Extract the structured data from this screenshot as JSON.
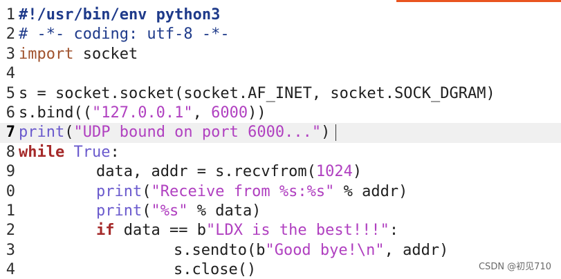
{
  "editor": {
    "accent_color": "#e95420",
    "lines": [
      {
        "num": "1",
        "tokens": [
          {
            "t": "#!/usr/bin/env python3",
            "c": "shebang"
          }
        ]
      },
      {
        "num": "2",
        "tokens": [
          {
            "t": "# -*- coding: utf-8 -*-",
            "c": "comment-line"
          }
        ]
      },
      {
        "num": "3",
        "tokens": [
          {
            "t": "import",
            "c": "kw-import"
          },
          {
            "t": " socket",
            "c": "plain"
          }
        ]
      },
      {
        "num": "4",
        "tokens": []
      },
      {
        "num": "5",
        "tokens": [
          {
            "t": "s = socket.socket(socket.AF_INET, socket.SOCK_DGRAM)",
            "c": "plain"
          }
        ]
      },
      {
        "num": "6",
        "tokens": [
          {
            "t": "s.bind((",
            "c": "plain"
          },
          {
            "t": "\"127.0.0.1\"",
            "c": "string"
          },
          {
            "t": ", ",
            "c": "plain"
          },
          {
            "t": "6000",
            "c": "number"
          },
          {
            "t": "))",
            "c": "plain"
          }
        ]
      },
      {
        "num": "7",
        "current": true,
        "tokens": [
          {
            "t": "print",
            "c": "builtin"
          },
          {
            "t": "(",
            "c": "plain"
          },
          {
            "t": "\"UDP bound on port 6000...\"",
            "c": "string"
          },
          {
            "t": ")",
            "c": "plain"
          }
        ]
      },
      {
        "num": "8",
        "tokens": [
          {
            "t": "while",
            "c": "kw-bold"
          },
          {
            "t": " ",
            "c": "plain"
          },
          {
            "t": "True",
            "c": "builtin"
          },
          {
            "t": ":",
            "c": "plain"
          }
        ]
      },
      {
        "num": "9",
        "indent": 1,
        "tokens": [
          {
            "t": "data, addr = s.recvfrom(",
            "c": "plain"
          },
          {
            "t": "1024",
            "c": "number"
          },
          {
            "t": ")",
            "c": "plain"
          }
        ]
      },
      {
        "num": "0",
        "indent": 1,
        "tokens": [
          {
            "t": "print",
            "c": "builtin"
          },
          {
            "t": "(",
            "c": "plain"
          },
          {
            "t": "\"Receive from %s:%s\"",
            "c": "string"
          },
          {
            "t": " % addr)",
            "c": "plain"
          }
        ]
      },
      {
        "num": "1",
        "indent": 1,
        "tokens": [
          {
            "t": "print",
            "c": "builtin"
          },
          {
            "t": "(",
            "c": "plain"
          },
          {
            "t": "\"%s\"",
            "c": "string"
          },
          {
            "t": " % data)",
            "c": "plain"
          }
        ]
      },
      {
        "num": "2",
        "indent": 1,
        "tokens": [
          {
            "t": "if",
            "c": "kw-bold"
          },
          {
            "t": " data == b",
            "c": "plain"
          },
          {
            "t": "\"LDX is the best!!!\"",
            "c": "string"
          },
          {
            "t": ":",
            "c": "plain"
          }
        ]
      },
      {
        "num": "3",
        "indent": 2,
        "tokens": [
          {
            "t": "s.sendto(b",
            "c": "plain"
          },
          {
            "t": "\"Good bye!\\n\"",
            "c": "string"
          },
          {
            "t": ", addr)",
            "c": "plain"
          }
        ]
      },
      {
        "num": "4",
        "indent": 2,
        "tokens": [
          {
            "t": "s.close()",
            "c": "plain"
          }
        ]
      }
    ]
  },
  "watermark": "CSDN @初见710"
}
